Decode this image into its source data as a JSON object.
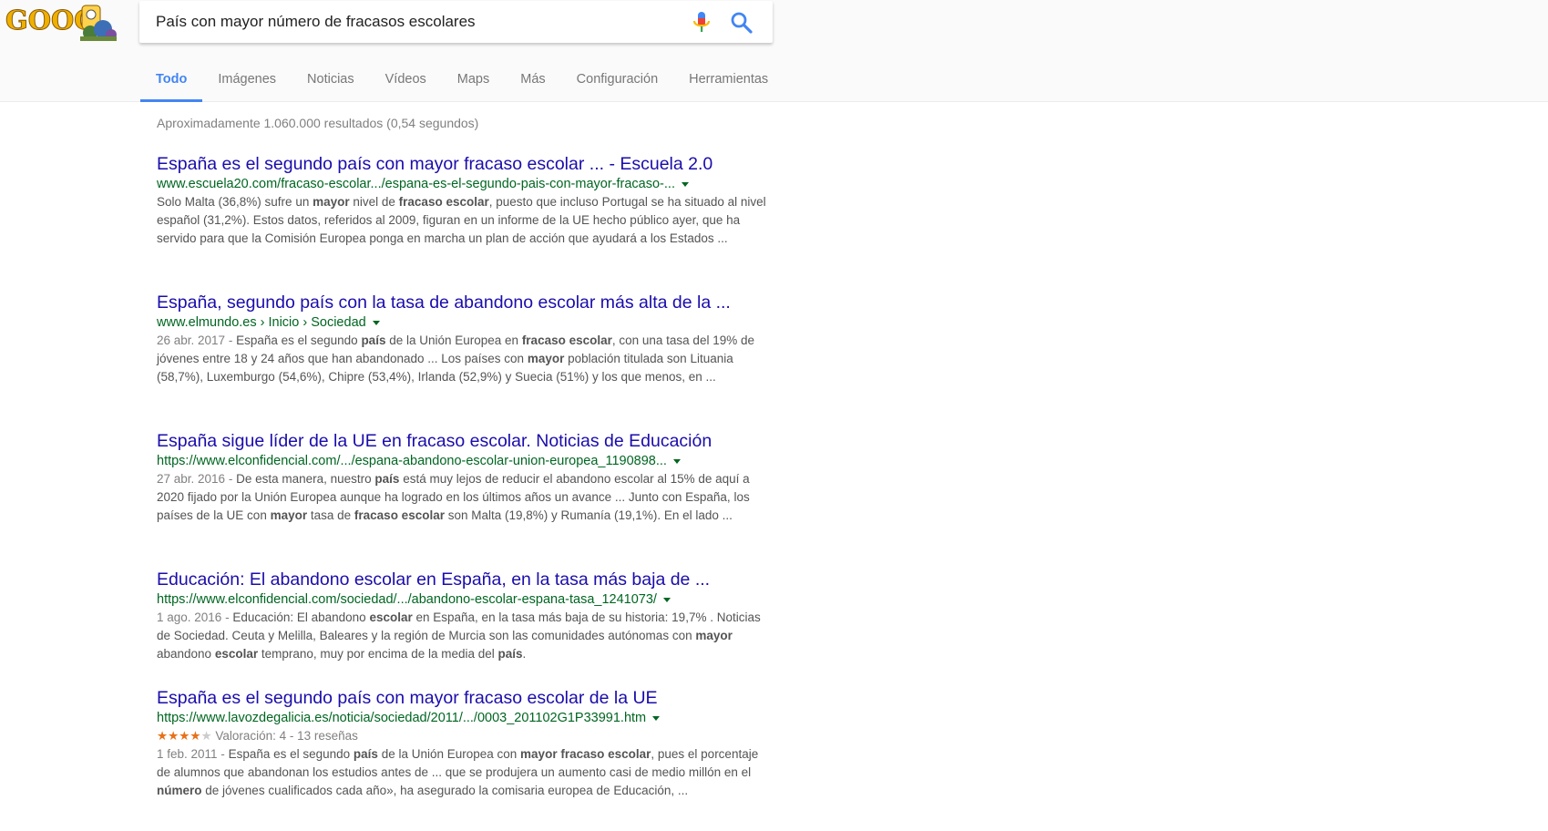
{
  "brand": {
    "logo_text": "GOOG",
    "blue": "#4285f4",
    "link_color": "#1a0dab",
    "url_color": "#006621",
    "star_color": "#e7711b"
  },
  "search": {
    "query": "País con mayor número de fracasos escolares",
    "mic_icon": "microphone-icon",
    "search_icon": "magnifier-icon"
  },
  "tabs": [
    {
      "label": "Todo",
      "active": true
    },
    {
      "label": "Imágenes"
    },
    {
      "label": "Noticias"
    },
    {
      "label": "Vídeos"
    },
    {
      "label": "Maps"
    },
    {
      "label": "Más"
    },
    {
      "label": "Configuración"
    },
    {
      "label": "Herramientas"
    }
  ],
  "stats": "Aproximadamente 1.060.000 resultados (0,54 segundos)",
  "results": [
    {
      "title": "España es el segundo país con mayor fracaso escolar ... - Escuela 2.0",
      "url": "www.escuela20.com/fracaso-escolar.../espana-es-el-segundo-pais-con-mayor-fracaso-...",
      "date": "",
      "snippet": [
        {
          "t": "Solo Malta (36,8%) sufre un "
        },
        {
          "t": "mayor",
          "b": true
        },
        {
          "t": " nivel de "
        },
        {
          "t": "fracaso escolar",
          "b": true
        },
        {
          "t": ", puesto que incluso Portugal se ha situado al nivel español (31,2%). Estos datos, referidos al 2009, figuran en un informe de la UE hecho público ayer, que ha servido para que la Comisión Europea ponga en marcha un plan de acción que ayudará a los Estados ..."
        }
      ]
    },
    {
      "title": "España, segundo país con la tasa de abandono escolar más alta de la ...",
      "url": "www.elmundo.es › Inicio › Sociedad",
      "date": "26 abr. 2017 - ",
      "snippet": [
        {
          "t": "España es el segundo "
        },
        {
          "t": "país",
          "b": true
        },
        {
          "t": " de la Unión Europea en "
        },
        {
          "t": "fracaso escolar",
          "b": true
        },
        {
          "t": ", con una tasa del 19% de jóvenes entre 18 y 24 años que han abandonado ... Los países con "
        },
        {
          "t": "mayor",
          "b": true
        },
        {
          "t": " población titulada son Lituania (58,7%), Luxemburgo (54,6%), Chipre (53,4%), Irlanda (52,9%) y Suecia (51%) y los que menos, en ..."
        }
      ]
    },
    {
      "title": "España sigue líder de la UE en fracaso escolar. Noticias de Educación",
      "url": "https://www.elconfidencial.com/.../espana-abandono-escolar-union-europea_1190898...",
      "date": "27 abr. 2016 - ",
      "snippet": [
        {
          "t": "De esta manera, nuestro "
        },
        {
          "t": "país",
          "b": true
        },
        {
          "t": " está muy lejos de reducir el abandono escolar al 15% de aquí a 2020 fijado por la Unión Europea aunque ha logrado en los últimos años un avance ... Junto con España, los países de la UE con "
        },
        {
          "t": "mayor",
          "b": true
        },
        {
          "t": " tasa de "
        },
        {
          "t": "fracaso escolar",
          "b": true
        },
        {
          "t": " son Malta (19,8%) y Rumanía (19,1%). En el lado ..."
        }
      ]
    },
    {
      "title": "Educación: El abandono escolar en España, en la tasa más baja de ...",
      "url": "https://www.elconfidencial.com/sociedad/.../abandono-escolar-espana-tasa_1241073/",
      "date": "1 ago. 2016 - ",
      "snippet": [
        {
          "t": "Educación: El abandono "
        },
        {
          "t": "escolar",
          "b": true
        },
        {
          "t": " en España, en la tasa más baja de su historia: 19,7% . Noticias de Sociedad. Ceuta y Melilla, Baleares y la región de Murcia son las comunidades autónomas con "
        },
        {
          "t": "mayor",
          "b": true
        },
        {
          "t": " abandono "
        },
        {
          "t": "escolar",
          "b": true
        },
        {
          "t": " temprano, muy por encima de la media del "
        },
        {
          "t": "país",
          "b": true
        },
        {
          "t": "."
        }
      ]
    },
    {
      "title": "España es el segundo país con mayor fracaso escolar de la UE",
      "url": "https://www.lavozdegalicia.es/noticia/sociedad/2011/.../0003_201102G1P33991.htm",
      "rating": {
        "stars": 4,
        "max": 5,
        "text": "Valoración: 4 - 13 reseñas"
      },
      "date": "1 feb. 2011 - ",
      "snippet": [
        {
          "t": "España es el segundo "
        },
        {
          "t": "país",
          "b": true
        },
        {
          "t": " de la Unión Europea con "
        },
        {
          "t": "mayor fracaso escolar",
          "b": true
        },
        {
          "t": ", pues el porcentaje de alumnos que abandonan los estudios antes de ... que se produjera un aumento casi de medio millón en el "
        },
        {
          "t": "número",
          "b": true
        },
        {
          "t": " de jóvenes cualificados cada año», ha asegurado la comisaria europea de Educación, ..."
        }
      ]
    }
  ]
}
